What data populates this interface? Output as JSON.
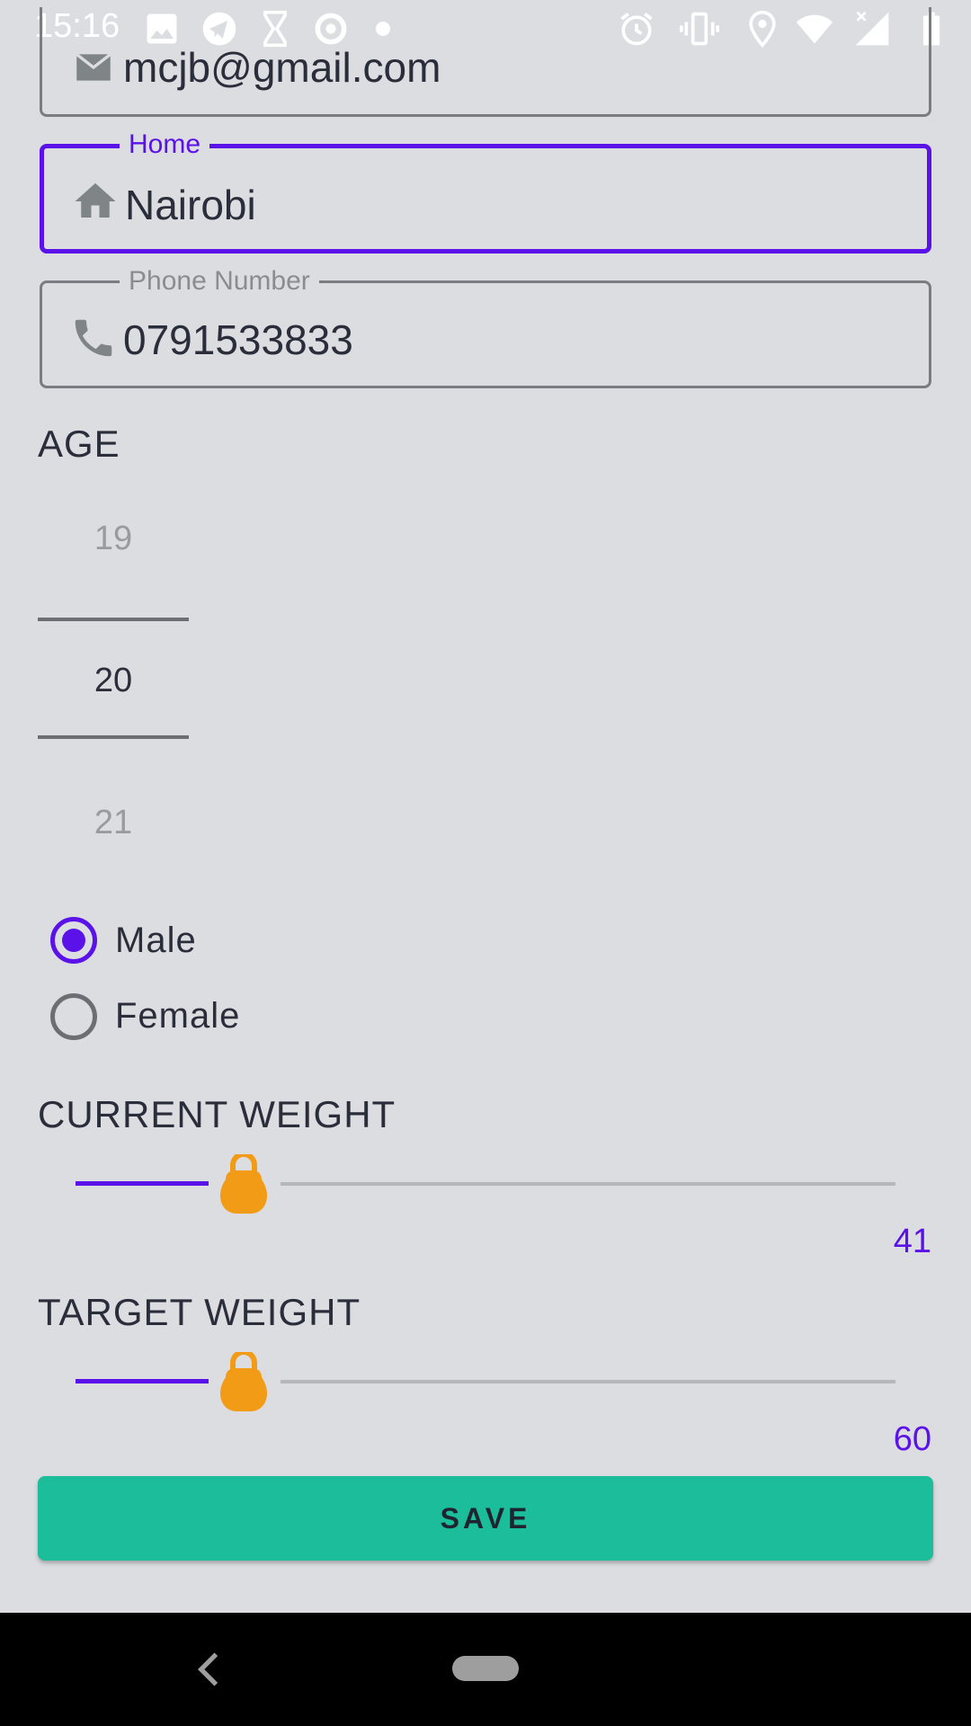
{
  "status_bar": {
    "time": "15:16",
    "left_icons": [
      "image-icon",
      "telegram-icon",
      "hourglass-icon",
      "sync-icon",
      "dot-icon"
    ],
    "right_icons": [
      "alarm-icon",
      "vibrate-icon",
      "location-icon",
      "wifi-icon",
      "signal-icon",
      "battery-icon"
    ]
  },
  "form": {
    "email": {
      "value": "mcjb@gmail.com",
      "icon": "mail-icon"
    },
    "home": {
      "label": "Home",
      "value": "Nairobi",
      "icon": "home-icon"
    },
    "phone": {
      "label": "Phone Number",
      "value": "0791533833",
      "icon": "phone-icon"
    }
  },
  "age": {
    "title": "AGE",
    "previous": "19",
    "selected": "20",
    "next": "21"
  },
  "gender": {
    "options": [
      {
        "label": "Male",
        "checked": true
      },
      {
        "label": "Female",
        "checked": false
      }
    ]
  },
  "current_weight": {
    "title": "CURRENT WEIGHT",
    "value": "41",
    "fraction": 0.205
  },
  "target_weight": {
    "title": "TARGET WEIGHT",
    "value": "60",
    "fraction": 0.205
  },
  "save_label": "SAVE",
  "colors": {
    "accent": "#5a12e8",
    "save_button": "#1bbd9a",
    "slider_thumb": "#f29b17",
    "background": "#dcdde1"
  }
}
